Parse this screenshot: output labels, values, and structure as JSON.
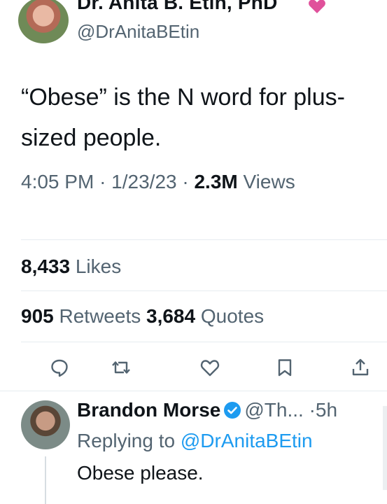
{
  "tweet": {
    "author_name": "Dr. Anita B. Etin, PhD",
    "author_handle": "@DrAnitaBEtin",
    "text": "“Obese” is the N word for plus-sized people.",
    "time": "4:05 PM",
    "date": "1/23/23",
    "views_count": "2.3M",
    "views_label": "Views",
    "sep": "·"
  },
  "stats": {
    "likes_count": "8,433",
    "likes_label": "Likes",
    "retweets_count": "905",
    "retweets_label": "Retweets",
    "quotes_count": "3,684",
    "quotes_label": "Quotes"
  },
  "actions": {
    "reply_icon": "comment-icon",
    "retweet_icon": "retweet-icon",
    "like_icon": "heart-outline-icon",
    "bookmark_icon": "bookmark-icon",
    "share_icon": "share-icon"
  },
  "reply": {
    "author_name": "Brandon Morse",
    "author_handle": "@Th...",
    "sep": "·",
    "time": "5h",
    "replying_prefix": "Replying to",
    "replying_handle": "@DrAnitaBEtin",
    "text": "Obese please."
  },
  "colors": {
    "accent": "#1d9bf0",
    "secondary_text": "#536471",
    "heart": "#e0245e"
  }
}
